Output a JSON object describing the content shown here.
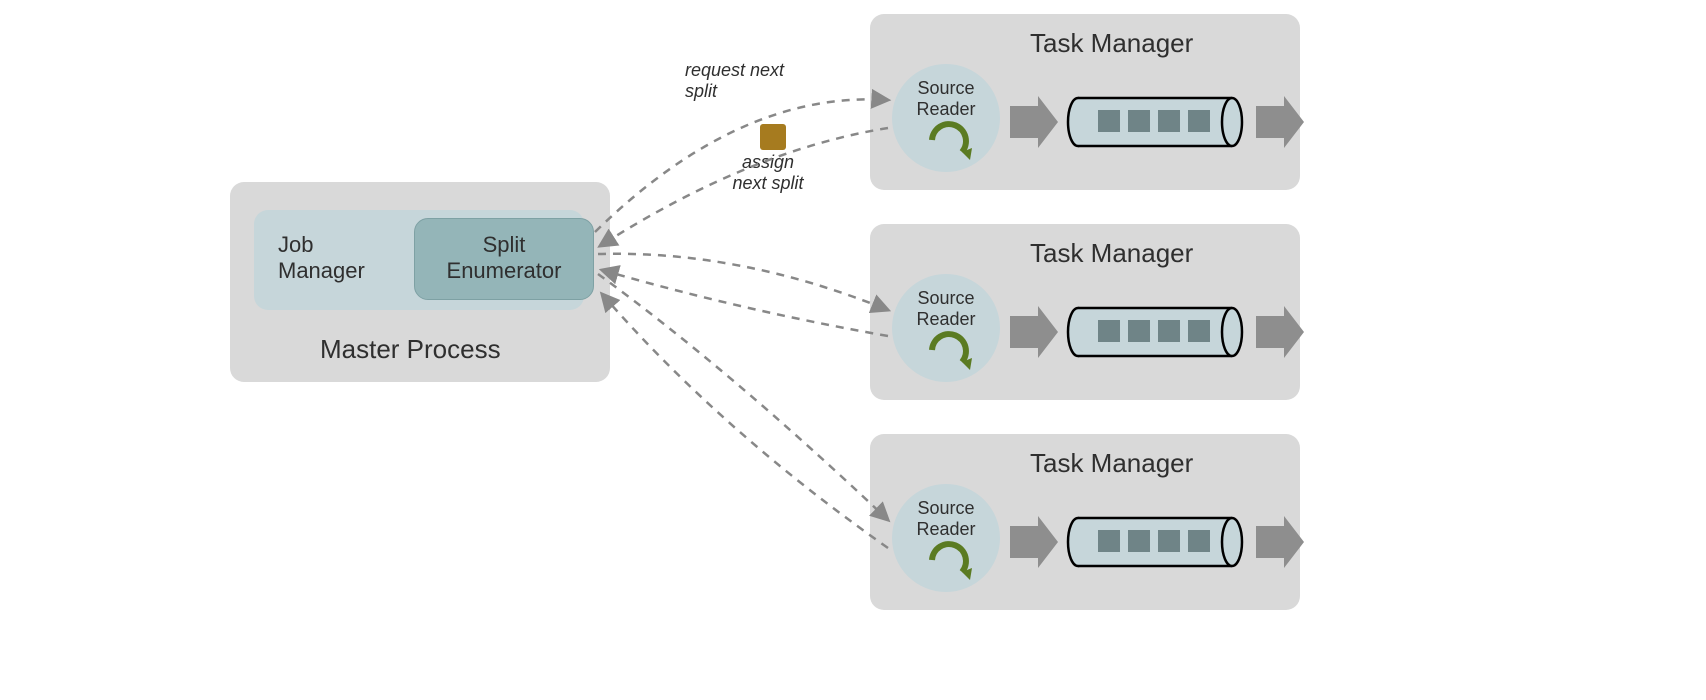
{
  "master": {
    "label": "Master Process",
    "job_manager": "Job\nManager",
    "split_enumerator": "Split\nEnumerator"
  },
  "messages": {
    "request": "request next\nsplit",
    "assign": "assign\nnext split"
  },
  "task_managers": [
    {
      "title": "Task Manager",
      "source_reader": "Source\nReader"
    },
    {
      "title": "Task Manager",
      "source_reader": "Source\nReader"
    },
    {
      "title": "Task Manager",
      "source_reader": "Source\nReader"
    }
  ],
  "colors": {
    "panel_grey": "#d9d9d9",
    "panel_blue": "#c6d6da",
    "panel_teal": "#94b5b8",
    "arrow_grey": "#8e8e8e",
    "dash_grey": "#888888",
    "cycle_green": "#5b7b22",
    "cube_brown": "#a67b1f",
    "pipe_fill": "#c6d6da",
    "pipe_chip": "#6f8487"
  }
}
